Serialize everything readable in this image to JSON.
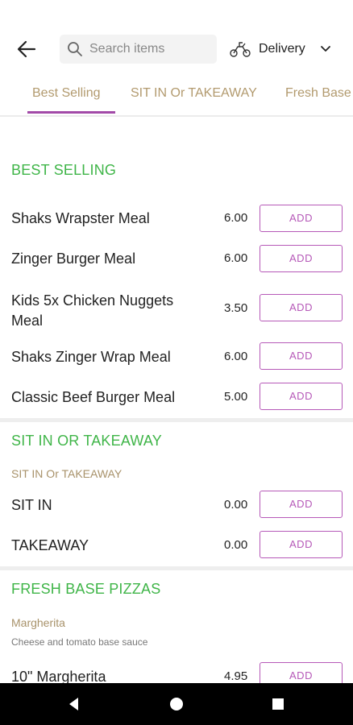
{
  "header": {
    "search_placeholder": "Search items",
    "delivery_label": "Delivery"
  },
  "tabs": [
    {
      "label": "Best Selling"
    },
    {
      "label": "SIT IN Or TAKEAWAY"
    },
    {
      "label": "Fresh Base"
    }
  ],
  "sections": [
    {
      "title": "BEST SELLING",
      "items": [
        {
          "name": "Shaks Wrapster Meal",
          "price": "6.00",
          "button": "ADD"
        },
        {
          "name": "Zinger Burger Meal",
          "price": "6.00",
          "button": "ADD"
        },
        {
          "name": "Kids 5x Chicken Nuggets Meal",
          "price": "3.50",
          "button": "ADD"
        },
        {
          "name": "Shaks Zinger Wrap Meal",
          "price": "6.00",
          "button": "ADD"
        },
        {
          "name": "Classic Beef Burger Meal",
          "price": "5.00",
          "button": "ADD"
        }
      ]
    },
    {
      "title": "SIT IN OR TAKEAWAY",
      "subtitle": "SIT IN Or TAKEAWAY",
      "items": [
        {
          "name": "SIT IN",
          "price": "0.00",
          "button": "ADD"
        },
        {
          "name": "TAKEAWAY",
          "price": "0.00",
          "button": "ADD"
        }
      ]
    },
    {
      "title": "FRESH BASE PIZZAS",
      "subtitle": "Margherita",
      "description": "Cheese and tomato base sauce",
      "items": [
        {
          "name": "10\" Margherita",
          "price": "4.95",
          "button": "ADD"
        }
      ]
    }
  ],
  "colors": {
    "accent": "#a24aa8",
    "section_title": "#3fb548",
    "tab_text": "#b29a6e"
  }
}
